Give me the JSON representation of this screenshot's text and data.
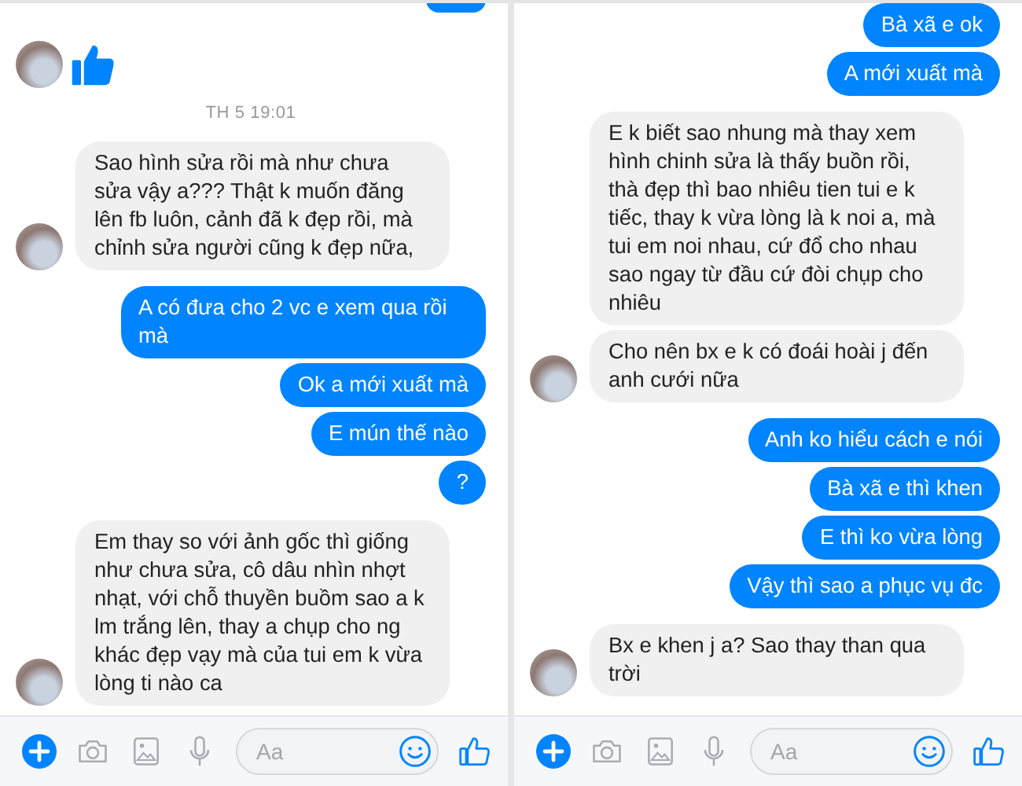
{
  "panels": [
    {
      "messages": [
        {
          "kind": "clipped"
        },
        {
          "kind": "like",
          "avatar": true
        },
        {
          "kind": "time",
          "text": "TH 5 19:01"
        },
        {
          "kind": "received",
          "text": "Sao hình sửa rồi mà như chưa sửa vậy a??? Thật k muốn đăng lên fb luôn, cảnh đã k đẹp rồi, mà chỉnh sửa người cũng k đẹp nữa,",
          "avatar": true
        },
        {
          "kind": "sent",
          "text": "A có đưa cho 2 vc e xem qua rồi mà"
        },
        {
          "kind": "sent",
          "text": "Ok a mới xuất mà"
        },
        {
          "kind": "sent",
          "text": "E mún thế nào"
        },
        {
          "kind": "sent",
          "text": "?"
        },
        {
          "kind": "received",
          "text": "Em thay so với ảnh gốc thì giống như chưa sửa, cô dâu nhìn nhợt nhạt, với chỗ thuyền buồm sao a k lm trắng lên, thay a chụp cho ng khác đẹp vạy mà của tui em k vừa lòng ti nào ca",
          "avatar": true
        }
      ],
      "composer": {
        "placeholder": "Aa"
      }
    },
    {
      "messages": [
        {
          "kind": "sent",
          "text": "Bà xã e ok"
        },
        {
          "kind": "sent",
          "text": "A mới xuất mà"
        },
        {
          "kind": "received",
          "text": "E k biết sao nhung mà thay xem hình chinh sửa là thấy buồn rồi, thà đẹp thì bao nhiêu tien tui e k tiếc, thay k vừa lòng là k noi a, mà tui em noi nhau, cứ đổ cho nhau sao ngay từ đầu cứ đòi chụp cho nhiêu",
          "avatar": false
        },
        {
          "kind": "received",
          "text": "Cho nên bx e k có đoái hoài j đến anh cưới nữa",
          "avatar": true
        },
        {
          "kind": "sent",
          "text": "Anh ko hiểu cách e nói"
        },
        {
          "kind": "sent",
          "text": "Bà xã e thì khen"
        },
        {
          "kind": "sent",
          "text": "E thì ko vừa lòng"
        },
        {
          "kind": "sent",
          "text": "Vậy thì sao a phục vụ đc"
        },
        {
          "kind": "received",
          "text": "Bx e khen j a? Sao thay than qua trời",
          "avatar": true
        }
      ],
      "composer": {
        "placeholder": "Aa"
      }
    }
  ]
}
